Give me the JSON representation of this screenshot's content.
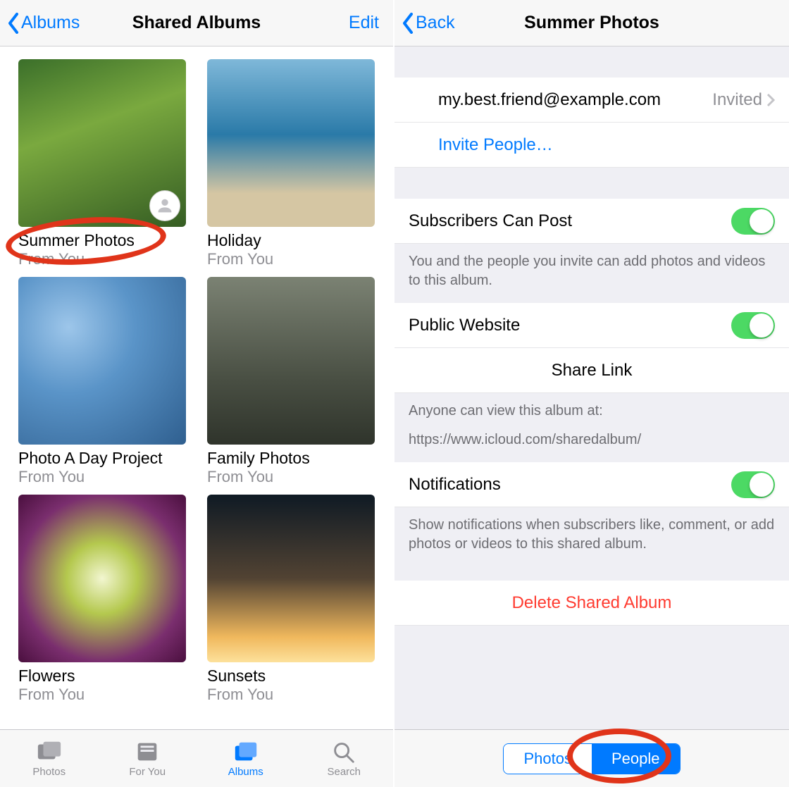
{
  "left": {
    "nav": {
      "back": "Albums",
      "title": "Shared Albums",
      "edit": "Edit"
    },
    "albums": [
      {
        "title": "Summer Photos",
        "sub": "From You"
      },
      {
        "title": "Holiday",
        "sub": "From You"
      },
      {
        "title": "Photo A Day Project",
        "sub": "From You"
      },
      {
        "title": "Family Photos",
        "sub": "From You"
      },
      {
        "title": "Flowers",
        "sub": "From You"
      },
      {
        "title": "Sunsets",
        "sub": "From You"
      }
    ],
    "tabs": {
      "photos": "Photos",
      "for_you": "For You",
      "albums": "Albums",
      "search": "Search"
    }
  },
  "right": {
    "nav": {
      "back": "Back",
      "title": "Summer Photos"
    },
    "invitee": {
      "email": "my.best.friend@example.com",
      "status": "Invited"
    },
    "invite_label": "Invite People…",
    "subscribers_label": "Subscribers Can Post",
    "subscribers_note": "You and the people you invite can add photos and videos to this album.",
    "public_label": "Public Website",
    "share_link_label": "Share Link",
    "share_note_1": "Anyone can view this album at:",
    "share_note_2": "https://www.icloud.com/sharedalbum/",
    "notifications_label": "Notifications",
    "notifications_note": "Show notifications when subscribers like, comment, or add photos or videos to this shared album.",
    "delete_label": "Delete Shared Album",
    "seg": {
      "photos": "Photos",
      "people": "People"
    }
  }
}
